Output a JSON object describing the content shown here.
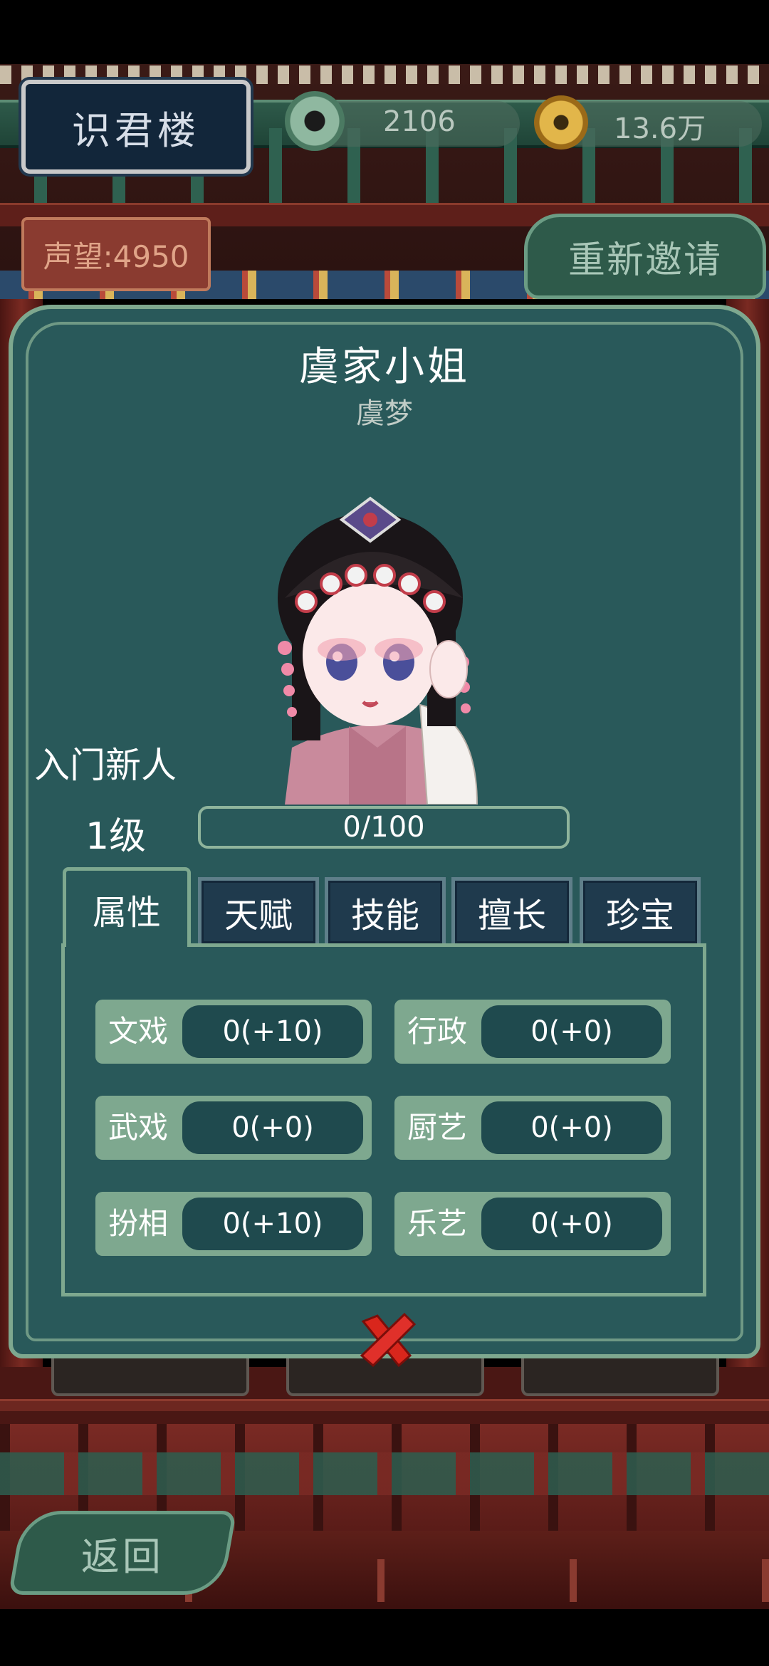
{
  "header": {
    "location_title": "识君楼",
    "jade_currency": "2106",
    "gold_currency": "13.6万",
    "fame": "声望:4950",
    "reinvite_label": "重新邀请"
  },
  "character": {
    "title": "虞家小姐",
    "name": "虞梦",
    "rank": "入门新人",
    "level": "1级",
    "exp_text": "0/100",
    "exp_fraction": 0
  },
  "tabs": [
    {
      "label": "属性"
    },
    {
      "label": "天赋"
    },
    {
      "label": "技能"
    },
    {
      "label": "擅长"
    },
    {
      "label": "珍宝"
    }
  ],
  "stats": [
    {
      "label": "文戏",
      "value": "0(+10)"
    },
    {
      "label": "行政",
      "value": "0(+0)"
    },
    {
      "label": "武戏",
      "value": "0(+0)"
    },
    {
      "label": "厨艺",
      "value": "0(+0)"
    },
    {
      "label": "扮相",
      "value": "0(+10)"
    },
    {
      "label": "乐艺",
      "value": "0(+0)"
    }
  ],
  "footer": {
    "back_label": "返回"
  },
  "icons": {
    "close": "close-x-icon",
    "jade": "jade-coin-icon",
    "gold": "gold-coin-icon"
  }
}
